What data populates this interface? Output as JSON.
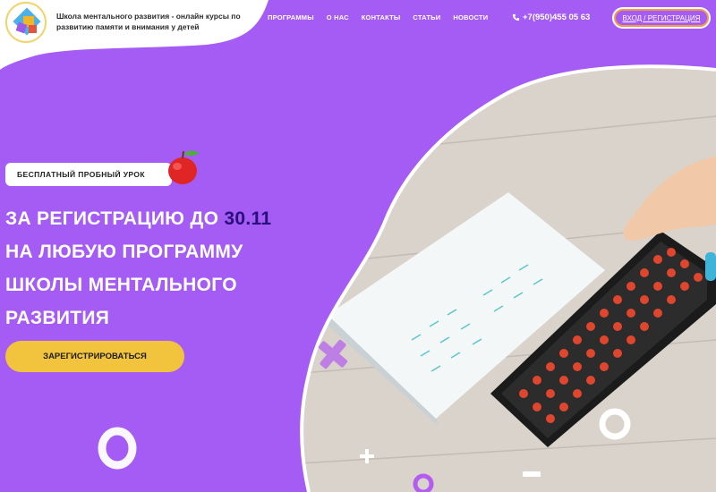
{
  "header": {
    "tagline": "Школа ментального развития - онлайн курсы по развитию памяти и внимания у детей",
    "nav": [
      "ПРОГРАММЫ",
      "О НАС",
      "КОНТАКТЫ",
      "СТАТЬИ",
      "НОВОСТИ"
    ],
    "phone": "+7(950)455 05 63",
    "login": "ВХОД / РЕГИСТРАЦИЯ"
  },
  "hero": {
    "badge": "БЕСПЛАТНЫЙ ПРОБНЫЙ УРОК",
    "line1_pre": "ЗА РЕГИСТРАЦИЮ ДО ",
    "line1_date": "30.11",
    "line2": "НА ЛЮБУЮ ПРОГРАММУ",
    "line3": "ШКОЛЫ МЕНТАЛЬНОГО",
    "line4": "РАЗВИТИЯ",
    "cta": "ЗАРЕГИСТРИРОВАТЬСЯ"
  },
  "colors": {
    "purple": "#a45cf4",
    "yellow": "#f2c33c",
    "dark": "#2a0f7a",
    "orange": "#f29a46"
  }
}
